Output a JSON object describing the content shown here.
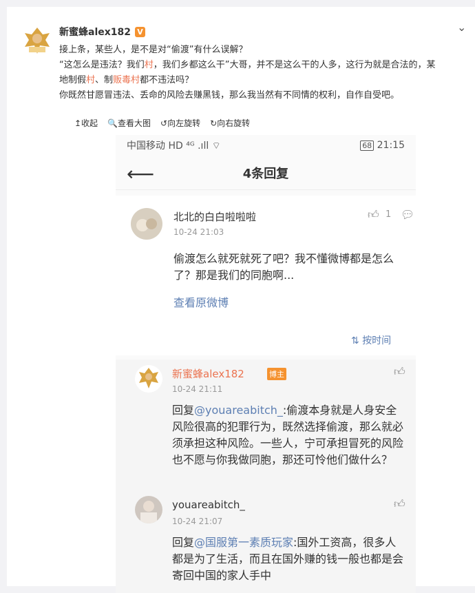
{
  "post": {
    "author": "新蜜蜂alex182",
    "verified": "V",
    "collapse_icon": "chevron-down-icon",
    "lines": [
      "接上条，某些人，是不是对“偷渡”有什么误解？",
      "“这怎么是违法？我们村，我们乡都这么干”大哥，并不是这么干的人多，这行为就是合法的，某",
      "地制假村、制贩毒村都不违法吗？",
      "你既然甘愿冒违法、丢命的风险去赚黑钱，那么我当然有不同情的权利，自作自受吧。"
    ],
    "line2_parts": [
      "“这怎么是违法？我们",
      "村",
      "，我们乡都这么干”大哥，并不是这么干的人多，这行为就是合法的，某"
    ],
    "line3_parts": [
      "地制假",
      "村",
      "、制",
      "贩毒村",
      "都不违法吗？"
    ]
  },
  "toolbar": {
    "collapse": "↥收起",
    "view_large": "🔍查看大图",
    "rotate_left": "↺向左旋转",
    "rotate_right": "↻向右旋转"
  },
  "screenshot": {
    "status": {
      "carrier": "中国移动",
      "signal": "HD ⁴ᴳ .ıll ⌔",
      "battery": "68",
      "time": "21:15"
    },
    "nav": {
      "back_icon": "arrow-left-icon",
      "title": "4条回复"
    },
    "original": {
      "user": "北北的白白啦啦啦",
      "time": "10-24 21:03",
      "likes": "1",
      "text": "偷渡怎么就死就死了吧？我不懂微博都是怎么了？那是我们的同胞啊...",
      "view_link": "查看原微博",
      "sort_label": "按时间"
    },
    "replies": [
      {
        "user": "新蜜蜂alex182",
        "badge": "博主",
        "time": "10-24 21:11",
        "prefix": "回复",
        "mention": "@youareabitch_",
        "text": ":偷渡本身就是人身安全风险很高的犯罪行为，既然选择偷渡，那么就必须承担这种风险。一些人，宁可承担冒死的风险也不愿与你我做同胞，那还可怜他们做什么？"
      },
      {
        "user": "youareabitch_",
        "time": "10-24 21:07",
        "prefix": "回复",
        "mention": "@国服第一素质玩家",
        "text": ":国外工资高，很多人都是为了生活，而且在国外赚的钱一般也都是会寄回中国的家人手中"
      }
    ]
  },
  "colors": {
    "accent": "#eb7350",
    "link": "#5d7fb3",
    "vip": "#f5922f"
  }
}
